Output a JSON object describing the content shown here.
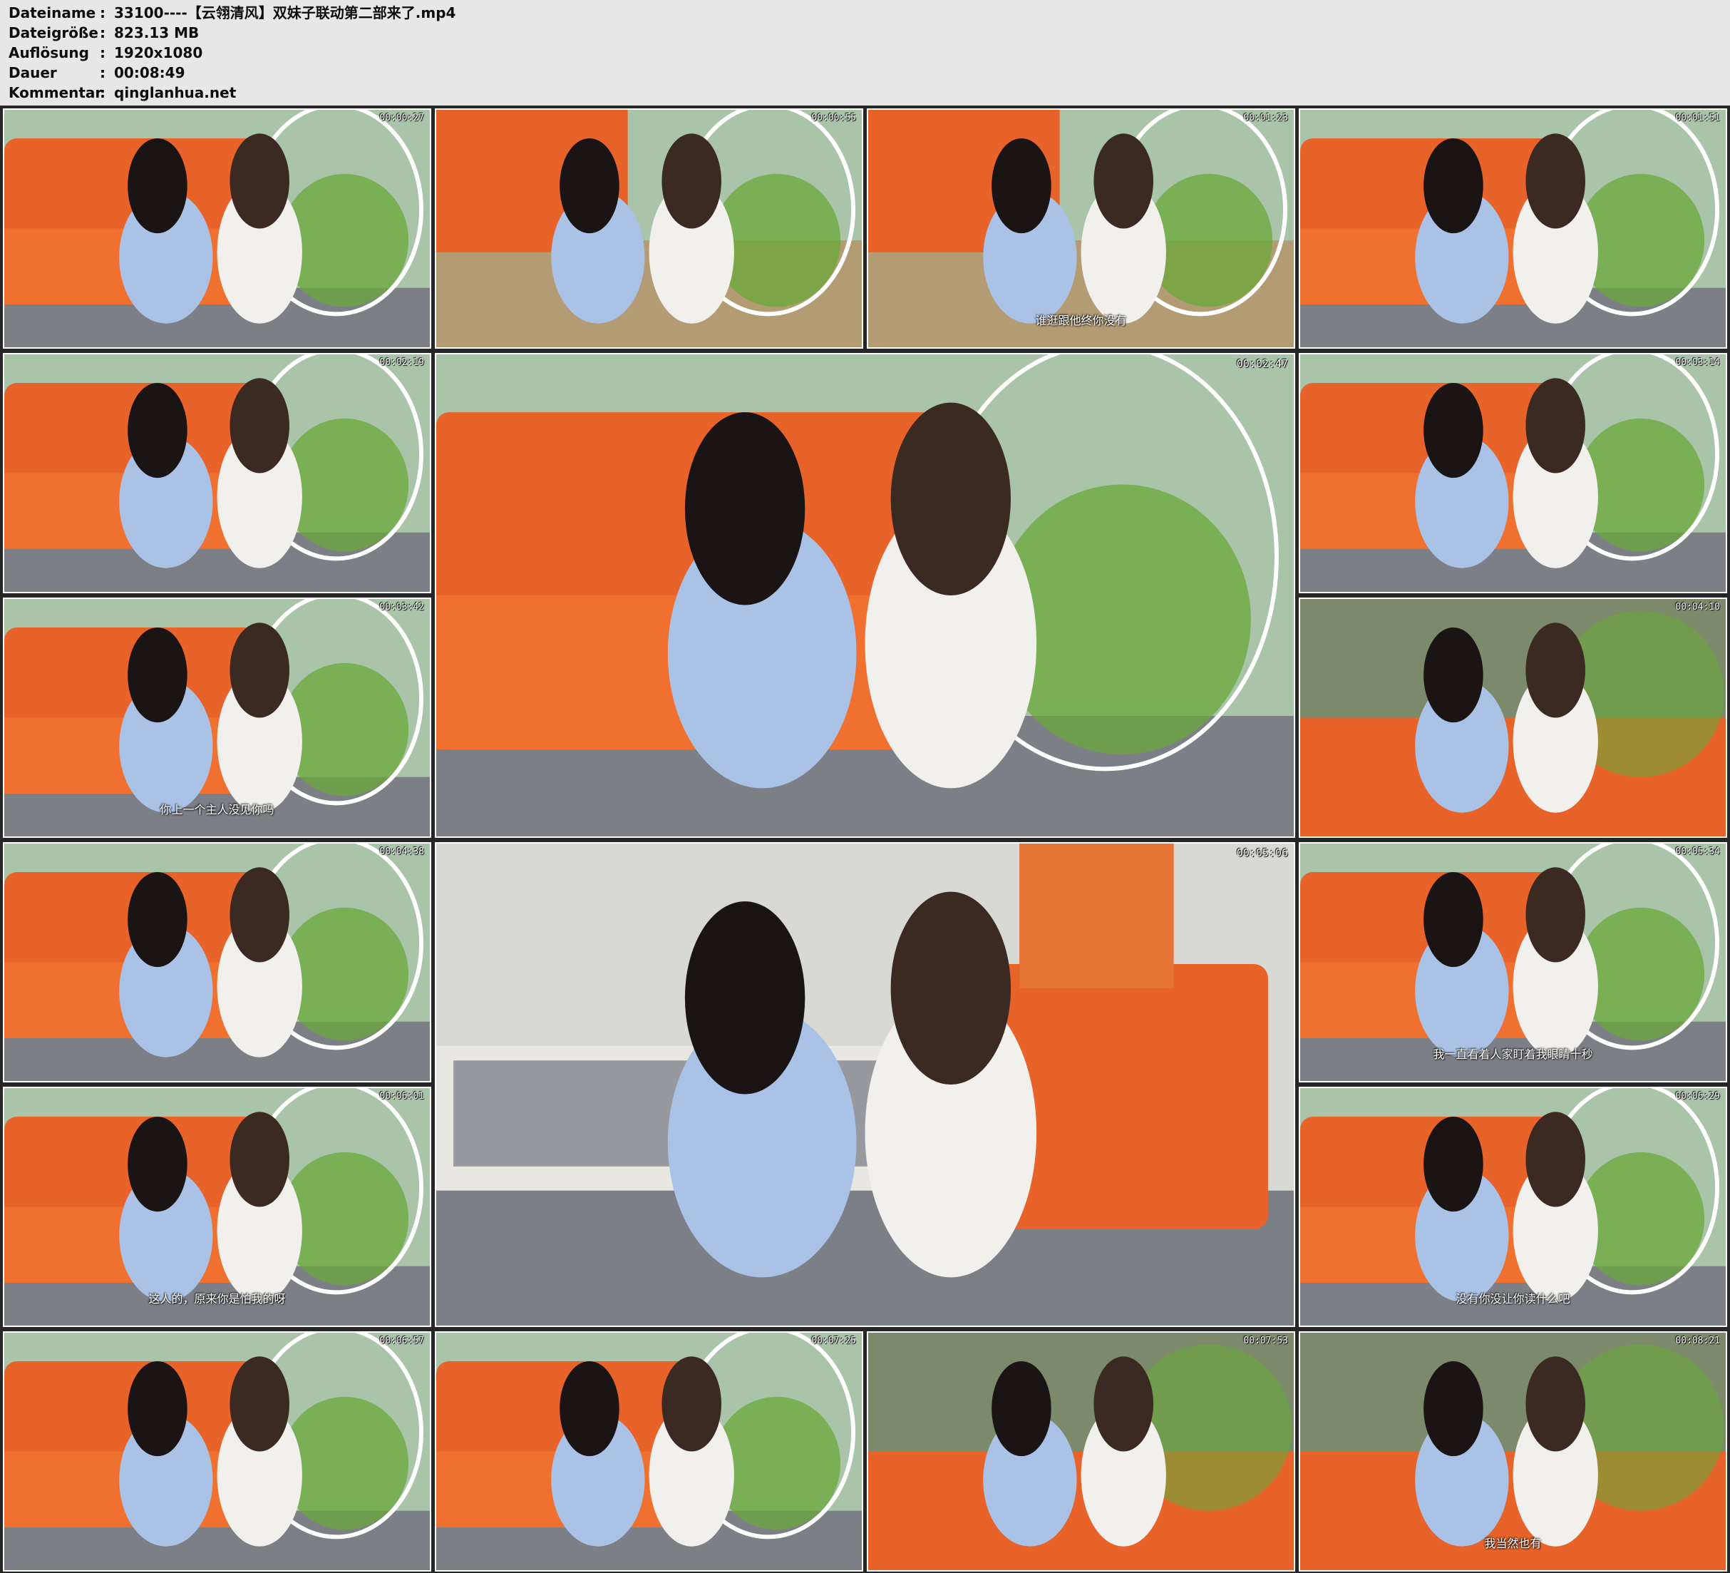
{
  "info": {
    "filename_label": "Dateiname",
    "filename": "33100----【云翎清风】双妹子联动第二部来了.mp4",
    "filesize_label": "Dateigröße",
    "filesize": "823.13 MB",
    "resolution_label": "Auflösung",
    "resolution": "1920x1080",
    "duration_label": "Dauer",
    "duration": "00:08:49",
    "comment_label": "Kommentar",
    "comment": "qinglanhua.net",
    "separator": ":"
  },
  "thumbnails": [
    {
      "timestamp": "00:00:27",
      "subtitle": "",
      "scene": "sofa"
    },
    {
      "timestamp": "00:00:55",
      "subtitle": "",
      "scene": "floor"
    },
    {
      "timestamp": "00:01:23",
      "subtitle": "谁逛跟他终你没有",
      "scene": "floor"
    },
    {
      "timestamp": "00:01:51",
      "subtitle": "",
      "scene": "chair"
    },
    {
      "timestamp": "00:02:19",
      "subtitle": "",
      "scene": "sofa"
    },
    {
      "timestamp": "00:02:47",
      "subtitle": "",
      "scene": "chair"
    },
    {
      "timestamp": "00:03:14",
      "subtitle": "",
      "scene": "chair"
    },
    {
      "timestamp": "00:03:42",
      "subtitle": "你上一个主人没见你吗",
      "scene": "sofa"
    },
    {
      "timestamp": "00:04:10",
      "subtitle": "",
      "scene": "closeup"
    },
    {
      "timestamp": "00:04:38",
      "subtitle": "",
      "scene": "sofa"
    },
    {
      "timestamp": "00:05:06",
      "subtitle": "",
      "scene": "bedroom"
    },
    {
      "timestamp": "00:05:34",
      "subtitle": "我一直看着人家盯着我眼睛十秒",
      "scene": "sofa"
    },
    {
      "timestamp": "00:06:01",
      "subtitle": "这人的，原来你是怕我的呀",
      "scene": "sofa"
    },
    {
      "timestamp": "00:06:29",
      "subtitle": "没有你没让你读什么吧",
      "scene": "sofa"
    },
    {
      "timestamp": "00:06:57",
      "subtitle": "",
      "scene": "sofa"
    },
    {
      "timestamp": "00:07:25",
      "subtitle": "",
      "scene": "sofa"
    },
    {
      "timestamp": "00:07:53",
      "subtitle": "",
      "scene": "closeup"
    },
    {
      "timestamp": "00:08:21",
      "subtitle": "我当然也有",
      "scene": "closeup"
    }
  ],
  "colors": {
    "sofa": "#e8632a",
    "wall": "#a9c4a8",
    "floor": "#7d7f86",
    "hair": "#1a1414",
    "dress_blue": "#a9c2e6",
    "white": "#f2f0ec",
    "chair_green": "#6aa83a",
    "grid_bg": "#262626"
  }
}
